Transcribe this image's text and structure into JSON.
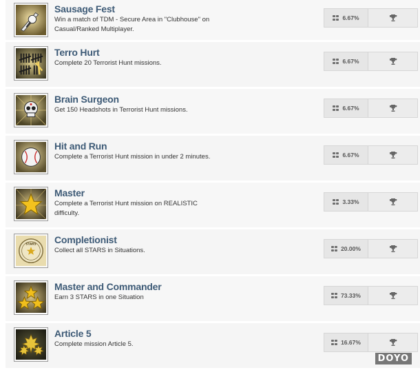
{
  "achievements": [
    {
      "title": "Sausage Fest",
      "description": "Win a match of TDM - Secure Area in \"Clubhouse\" on Casual/Ranked Multiplayer.",
      "percent": "6.67%",
      "icon": "knife-bird-icon"
    },
    {
      "title": "Terro Hurt",
      "description": "Complete 20 Terrorist Hunt missions.",
      "percent": "6.67%",
      "icon": "tally-marks-icon"
    },
    {
      "title": "Brain Surgeon",
      "description": "Get 150 Headshots in Terrorist Hunt missions.",
      "percent": "6.67%",
      "icon": "skull-icon"
    },
    {
      "title": "Hit and Run",
      "description": "Complete a Terrorist Hunt mission in under 2 minutes.",
      "percent": "6.67%",
      "icon": "baseball-icon"
    },
    {
      "title": "Master",
      "description": "Complete a Terrorist Hunt mission on REALISTIC difficulty.",
      "percent": "3.33%",
      "icon": "gold-star-icon"
    },
    {
      "title": "Completionist",
      "description": "Collect all STARS in Situations.",
      "percent": "20.00%",
      "icon": "stars-seal-icon",
      "seal_text": "STARS"
    },
    {
      "title": "Master and Commander",
      "description": "Earn 3 STARS in one Situation",
      "percent": "73.33%",
      "icon": "three-stars-icon"
    },
    {
      "title": "Article 5",
      "description": "Complete mission Article 5.",
      "percent": "16.67%",
      "icon": "maple-leaves-icon"
    }
  ],
  "watermark": "DOYO"
}
